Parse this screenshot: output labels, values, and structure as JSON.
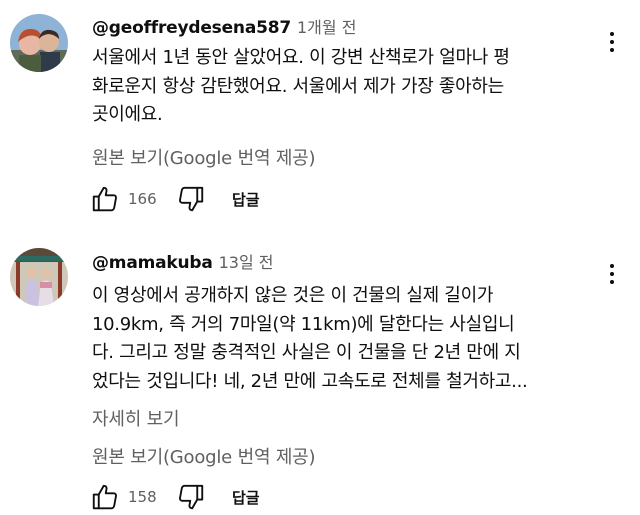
{
  "comments": [
    {
      "handle": "@geoffreydesena587",
      "time": "1개월 전",
      "lines": [
        "서울에서 1년 동안 살았어요. 이 강변 산책로가 얼마나 평",
        "화로운지 항상 감탄했어요. 서울에서 제가 가장 좋아하는",
        "곳이에요."
      ],
      "translate_label": "원본 보기(Google 번역 제공)",
      "likes": "166",
      "reply_label": "답글",
      "icons": {
        "like": "thumb-up-icon",
        "dislike": "thumb-down-icon",
        "more": "more-vert-icon"
      }
    },
    {
      "handle": "@mamakuba",
      "time": "13일 전",
      "lines": [
        "이 영상에서 공개하지 않은 것은 이 건물의 실제 길이가",
        "10.9km, 즉 거의 7마일(약 11km)에 달한다는 사실입니",
        "다. 그리고 정말 충격적인 사실은 이 건물을 단 2년 만에 지",
        "었다는 것입니다! 네, 2년 만에 고속도로 전체를 철거하고..."
      ],
      "read_more_label": "자세히 보기",
      "translate_label": "원본 보기(Google 번역 제공)",
      "likes": "158",
      "reply_label": "답글",
      "icons": {
        "like": "thumb-up-icon",
        "dislike": "thumb-down-icon",
        "more": "more-vert-icon"
      }
    }
  ],
  "colors": {
    "primary_text": "#0f0f0f",
    "secondary_text": "#606060",
    "background": "#ffffff"
  }
}
